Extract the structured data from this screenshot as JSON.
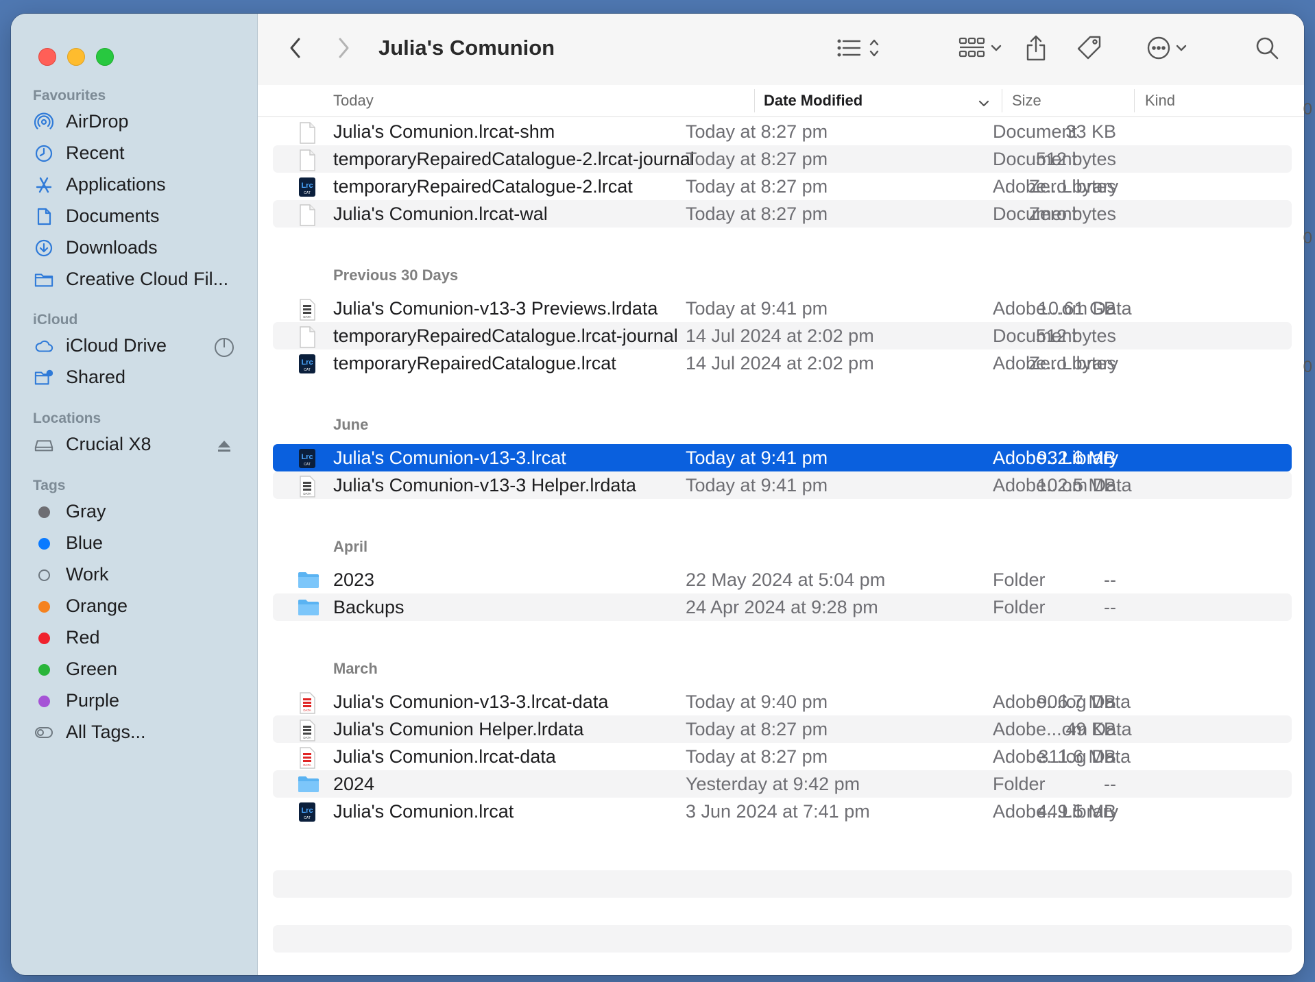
{
  "window": {
    "title": "Julia's Comunion"
  },
  "sidebar": {
    "favourites_heading": "Favourites",
    "favourites": [
      {
        "label": "AirDrop",
        "icon": "airdrop-icon"
      },
      {
        "label": "Recent",
        "icon": "clock-icon"
      },
      {
        "label": "Applications",
        "icon": "applications-icon"
      },
      {
        "label": "Documents",
        "icon": "document-icon"
      },
      {
        "label": "Downloads",
        "icon": "download-icon"
      },
      {
        "label": "Creative Cloud Fil...",
        "icon": "folder-icon"
      }
    ],
    "icloud_heading": "iCloud",
    "icloud": [
      {
        "label": "iCloud Drive",
        "icon": "cloud-icon"
      },
      {
        "label": "Shared",
        "icon": "shared-folder-icon"
      }
    ],
    "locations_heading": "Locations",
    "locations": [
      {
        "label": "Crucial X8",
        "icon": "drive-icon"
      }
    ],
    "tags_heading": "Tags",
    "tags": [
      {
        "label": "Gray",
        "color": "#6e6e73"
      },
      {
        "label": "Blue",
        "color": "#0a7aff"
      },
      {
        "label": "Work",
        "color": "none"
      },
      {
        "label": "Orange",
        "color": "#f5821f"
      },
      {
        "label": "Red",
        "color": "#f0222e"
      },
      {
        "label": "Green",
        "color": "#29b53a"
      },
      {
        "label": "Purple",
        "color": "#a553d6"
      },
      {
        "label": "All Tags...",
        "color": "all"
      }
    ]
  },
  "columns": {
    "name": "Today",
    "date": "Date Modified",
    "size": "Size",
    "kind": "Kind"
  },
  "groups": [
    {
      "title": "",
      "rows": [
        {
          "name": "Julia's Comunion.lrcat-shm",
          "date": "Today at 8:27 pm",
          "size": "33 KB",
          "kind": "Document",
          "icon": "blank-document-icon"
        },
        {
          "name": "temporaryRepairedCatalogue-2.lrcat-journal",
          "date": "Today at 8:27 pm",
          "size": "512 bytes",
          "kind": "Document",
          "icon": "blank-document-icon"
        },
        {
          "name": "temporaryRepairedCatalogue-2.lrcat",
          "date": "Today at 8:27 pm",
          "size": "Zero bytes",
          "kind": "Adobe...Library",
          "icon": "lrcat-icon"
        },
        {
          "name": "Julia's Comunion.lrcat-wal",
          "date": "Today at 8:27 pm",
          "size": "Zero bytes",
          "kind": "Document",
          "icon": "blank-document-icon"
        }
      ]
    },
    {
      "title": "Previous 30 Days",
      "rows": [
        {
          "name": "Julia's Comunion-v13-3 Previews.lrdata",
          "date": "Today at 9:41 pm",
          "size": "10.61 GB",
          "kind": "Adobe...om Data",
          "icon": "lrdata-icon"
        },
        {
          "name": "temporaryRepairedCatalogue.lrcat-journal",
          "date": "14 Jul 2024 at 2:02 pm",
          "size": "512 bytes",
          "kind": "Document",
          "icon": "blank-document-icon"
        },
        {
          "name": "temporaryRepairedCatalogue.lrcat",
          "date": "14 Jul 2024 at 2:02 pm",
          "size": "Zero bytes",
          "kind": "Adobe...Library",
          "icon": "lrcat-icon"
        }
      ]
    },
    {
      "title": "June",
      "rows": [
        {
          "name": "Julia's Comunion-v13-3.lrcat",
          "date": "Today at 9:41 pm",
          "size": "932.6 MB",
          "kind": "Adobe...Library",
          "icon": "lrcat-icon",
          "selected": true
        },
        {
          "name": "Julia's Comunion-v13-3 Helper.lrdata",
          "date": "Today at 9:41 pm",
          "size": "102.5 MB",
          "kind": "Adobe...om Data",
          "icon": "lrdata-icon"
        }
      ]
    },
    {
      "title": "April",
      "rows": [
        {
          "name": "2023",
          "date": "22 May 2024 at 5:04 pm",
          "size": "--",
          "kind": "Folder",
          "icon": "folder-icon"
        },
        {
          "name": "Backups",
          "date": "24 Apr 2024 at 9:28 pm",
          "size": "--",
          "kind": "Folder",
          "icon": "folder-icon"
        }
      ]
    },
    {
      "title": "March",
      "rows": [
        {
          "name": "Julia's Comunion-v13-3.lrcat-data",
          "date": "Today at 9:40 pm",
          "size": "906.7 MB",
          "kind": "Adobe...log Data",
          "icon": "lrcat-data-icon"
        },
        {
          "name": "Julia's Comunion Helper.lrdata",
          "date": "Today at 8:27 pm",
          "size": "49 KB",
          "kind": "Adobe...om Data",
          "icon": "lrdata-icon"
        },
        {
          "name": "Julia's Comunion.lrcat-data",
          "date": "Today at 8:27 pm",
          "size": "311.6 MB",
          "kind": "Adobe...log Data",
          "icon": "lrcat-data-icon"
        },
        {
          "name": "2024",
          "date": "Yesterday at 9:42 pm",
          "size": "--",
          "kind": "Folder",
          "icon": "folder-icon"
        },
        {
          "name": "Julia's Comunion.lrcat",
          "date": "3 Jun 2024 at 7:41 pm",
          "size": "449.5 MB",
          "kind": "Adobe...Library",
          "icon": "lrcat-icon"
        }
      ]
    }
  ],
  "colors": {
    "selection": "#0a60de",
    "sidebar": "#cfdde6",
    "accent": "#2f7ad8"
  }
}
